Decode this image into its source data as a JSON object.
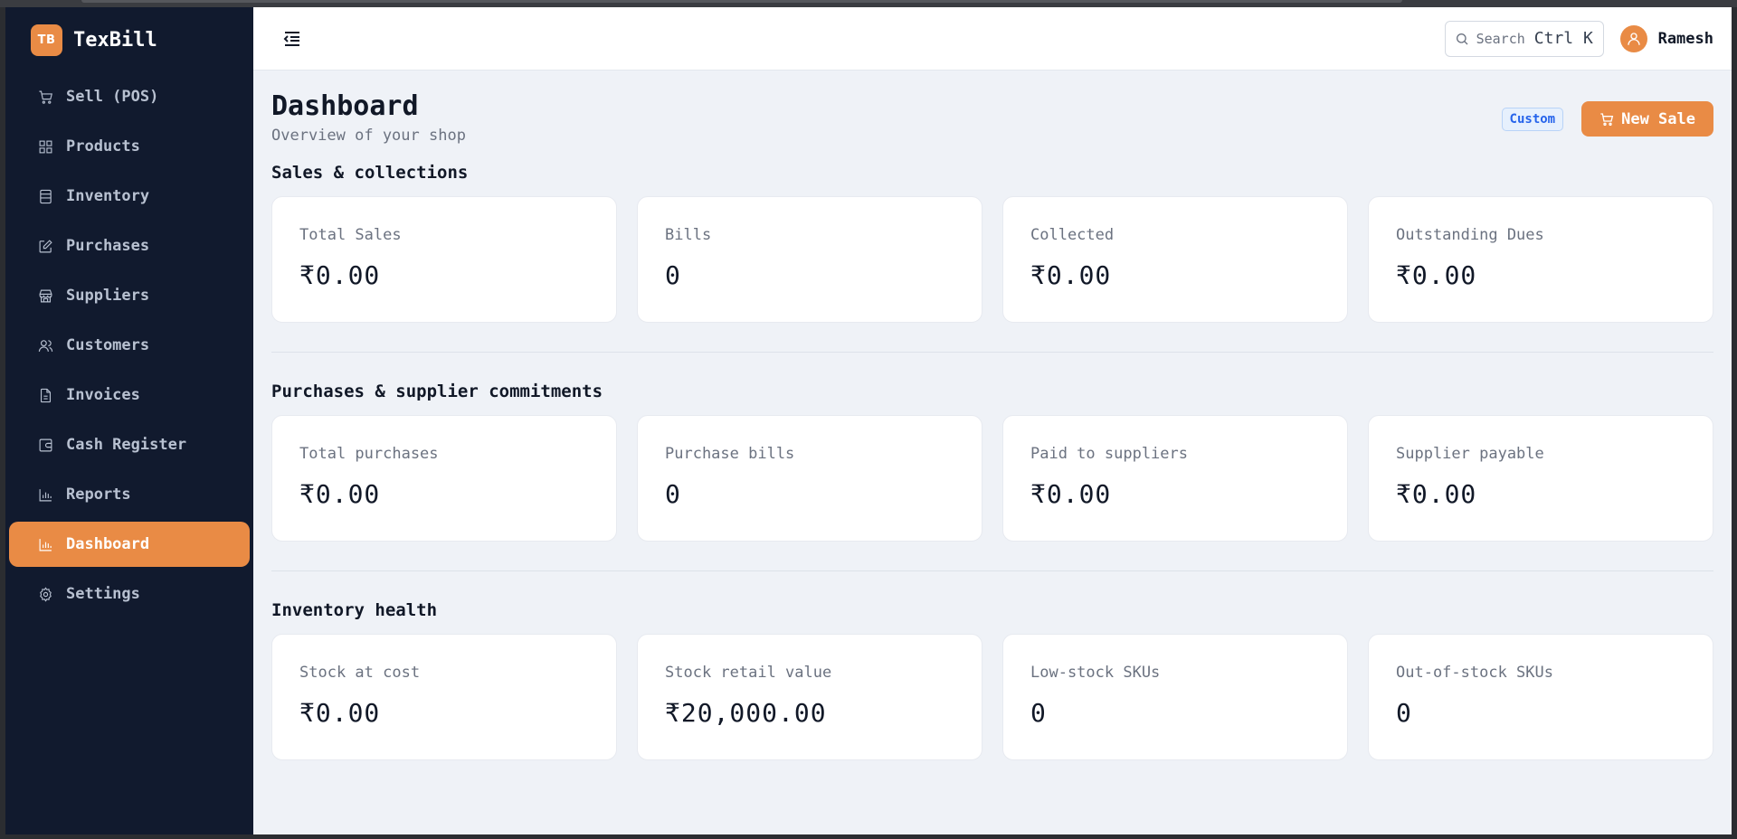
{
  "brand": {
    "badge": "TB",
    "name": "TexBill"
  },
  "sidebar": {
    "items": [
      {
        "label": "Sell (POS)",
        "icon": "cart-icon",
        "active": false
      },
      {
        "label": "Products",
        "icon": "grid-icon",
        "active": false
      },
      {
        "label": "Inventory",
        "icon": "inventory-icon",
        "active": false
      },
      {
        "label": "Purchases",
        "icon": "edit-icon",
        "active": false
      },
      {
        "label": "Suppliers",
        "icon": "store-icon",
        "active": false
      },
      {
        "label": "Customers",
        "icon": "users-icon",
        "active": false
      },
      {
        "label": "Invoices",
        "icon": "file-icon",
        "active": false
      },
      {
        "label": "Cash Register",
        "icon": "wallet-icon",
        "active": false
      },
      {
        "label": "Reports",
        "icon": "bar-chart-icon",
        "active": false
      },
      {
        "label": "Dashboard",
        "icon": "bar-chart-icon",
        "active": true
      },
      {
        "label": "Settings",
        "icon": "gear-icon",
        "active": false
      }
    ]
  },
  "header": {
    "search": {
      "placeholder": "Search",
      "shortcut": "Ctrl K"
    },
    "user": {
      "name": "Ramesh"
    }
  },
  "page": {
    "title": "Dashboard",
    "subtitle": "Overview of your shop",
    "range_badge": "Custom",
    "new_sale_label": "New Sale"
  },
  "sections": [
    {
      "title": "Sales & collections",
      "cards": [
        {
          "label": "Total Sales",
          "value": "₹0.00"
        },
        {
          "label": "Bills",
          "value": "0"
        },
        {
          "label": "Collected",
          "value": "₹0.00"
        },
        {
          "label": "Outstanding Dues",
          "value": "₹0.00"
        }
      ]
    },
    {
      "title": "Purchases & supplier commitments",
      "cards": [
        {
          "label": "Total purchases",
          "value": "₹0.00"
        },
        {
          "label": "Purchase bills",
          "value": "0"
        },
        {
          "label": "Paid to suppliers",
          "value": "₹0.00"
        },
        {
          "label": "Supplier payable",
          "value": "₹0.00"
        }
      ]
    },
    {
      "title": "Inventory health",
      "cards": [
        {
          "label": "Stock at cost",
          "value": "₹0.00"
        },
        {
          "label": "Stock retail value",
          "value": "₹20,000.00"
        },
        {
          "label": "Low-stock SKUs",
          "value": "0"
        },
        {
          "label": "Out-of-stock SKUs",
          "value": "0"
        }
      ]
    }
  ],
  "colors": {
    "accent": "#e98b45",
    "sidebar_bg": "#111a2e",
    "content_bg": "#eff2f7"
  }
}
